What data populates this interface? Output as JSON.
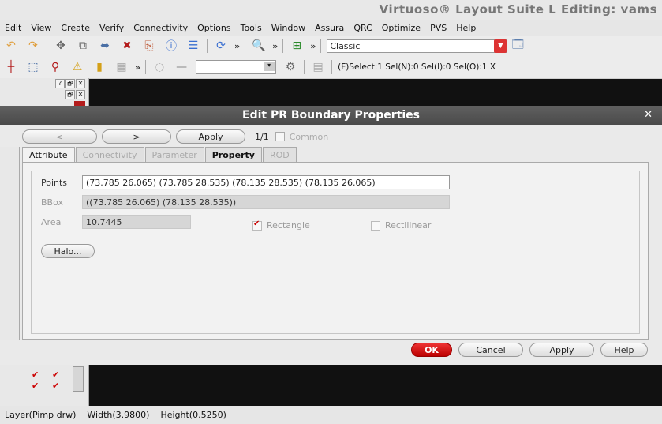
{
  "app_title": "Virtuoso® Layout Suite L Editing: vams",
  "menu": [
    "Edit",
    "View",
    "Create",
    "Verify",
    "Connectivity",
    "Options",
    "Tools",
    "Window",
    "Assura",
    "QRC",
    "Optimize",
    "PVS",
    "Help"
  ],
  "toolbar": {
    "mode_value": "Classic",
    "selection_status": "(F)Select:1   Sel(N):0   Sel(I):0   Sel(O):1   X"
  },
  "left_panel": {
    "btn_help": "?",
    "btn_float": "🗗",
    "btn_close": "✕"
  },
  "dialog": {
    "title": "Edit PR Boundary Properties",
    "prev_label": "<",
    "next_label": ">",
    "apply_nav_label": "Apply",
    "counter": "1/1",
    "common_label": "Common",
    "tabs": [
      "Attribute",
      "Connectivity",
      "Parameter",
      "Property",
      "ROD"
    ],
    "points_label": "Points",
    "points_value": "(73.785 26.065) (73.785 28.535) (78.135 28.535) (78.135 26.065)",
    "bbox_label": "BBox",
    "bbox_value": "((73.785 26.065) (78.135 28.535))",
    "area_label": "Area",
    "area_value": "10.7445",
    "rectangle_label": "Rectangle",
    "rectilinear_label": "Rectilinear",
    "halo_label": "Halo...",
    "ok_label": "OK",
    "cancel_label": "Cancel",
    "apply_label": "Apply",
    "help_label": "Help"
  },
  "status": {
    "layer": "Layer(Pimp drw)",
    "width": "Width(3.9800)",
    "height": "Height(0.5250)"
  }
}
